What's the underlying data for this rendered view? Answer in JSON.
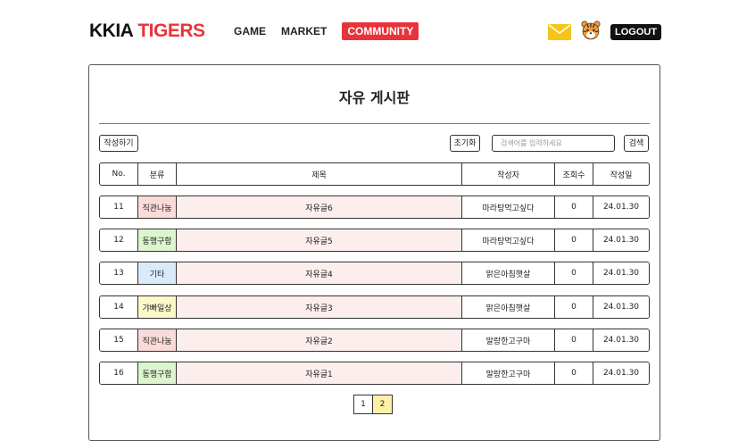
{
  "header": {
    "logo_main": "KKIA",
    "logo_accent": "TIGERS",
    "nav": [
      "GAME",
      "MARKET",
      "COMMUNITY"
    ],
    "logout_label": "LOGOUT",
    "icons": {
      "mail": "mail-icon",
      "profile": "tiger-avatar-icon"
    },
    "colors": {
      "accent": "#e8333a",
      "mail": "#f5c518",
      "tiger": "#f29b38"
    }
  },
  "board": {
    "title": "자유 게시판",
    "write_label": "작성하기",
    "reset_label": "초기화",
    "search_placeholder": "검색어를 입력하세요",
    "search_label": "검색",
    "columns": [
      "No.",
      "분류",
      "제목",
      "작성자",
      "조회수",
      "작성일"
    ],
    "rows": [
      {
        "no": "11",
        "category": "직관나눔",
        "category_color": "#fbdada",
        "title": "자유글6",
        "author": "마라탕먹고싶다",
        "views": "0",
        "date": "24.01.30"
      },
      {
        "no": "12",
        "category": "동행구함",
        "category_color": "#ddf5cf",
        "title": "자유글5",
        "author": "마라탕먹고싶다",
        "views": "0",
        "date": "24.01.30"
      },
      {
        "no": "13",
        "category": "기타",
        "category_color": "#d9ebfb",
        "title": "자유글4",
        "author": "맑은아침햇살",
        "views": "0",
        "date": "24.01.30"
      },
      {
        "no": "14",
        "category": "갸빠일상",
        "category_color": "#fdf8c9",
        "title": "자유글3",
        "author": "맑은아침햇살",
        "views": "0",
        "date": "24.01.30"
      },
      {
        "no": "15",
        "category": "직관나눔",
        "category_color": "#fbdada",
        "title": "자유글2",
        "author": "말랑한고구마",
        "views": "0",
        "date": "24.01.30"
      },
      {
        "no": "16",
        "category": "동행구함",
        "category_color": "#ddf5cf",
        "title": "자유글1",
        "author": "말랑한고구마",
        "views": "0",
        "date": "24.01.30"
      }
    ],
    "pagination": [
      "1",
      "2"
    ],
    "current_page": "2"
  }
}
